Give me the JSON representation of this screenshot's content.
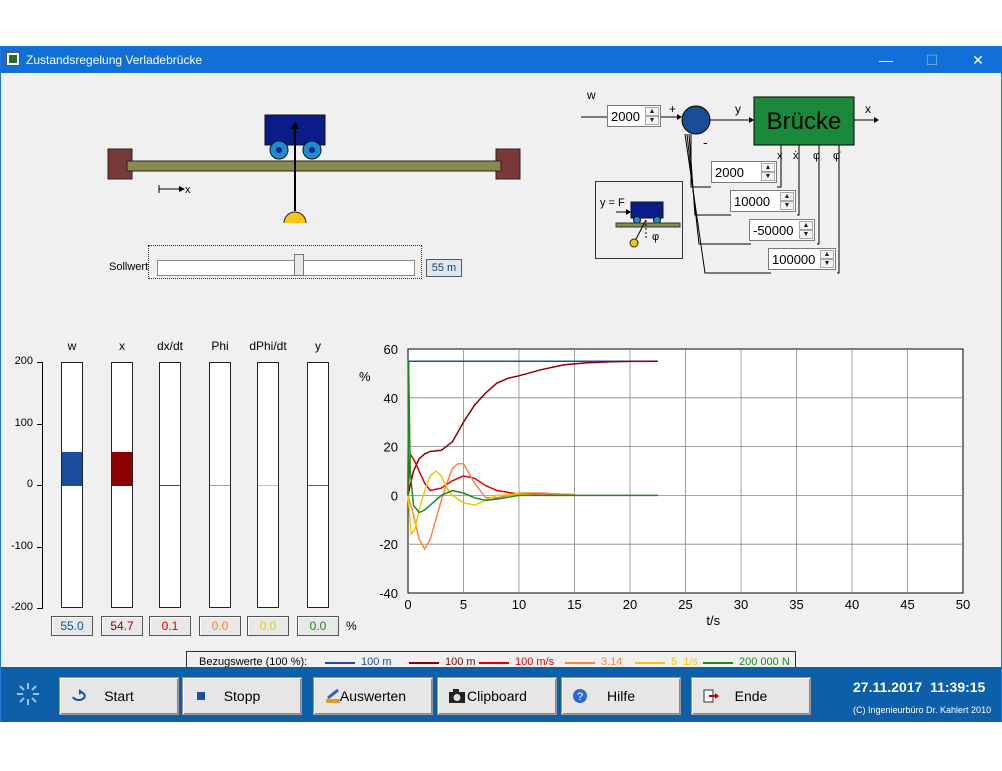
{
  "window": {
    "title": "Zustandsregelung Verladebrücke",
    "min": "—",
    "max": "☐",
    "close": "✕"
  },
  "crane": {
    "axis_label": "x",
    "slider_label": "Sollwert",
    "slider_value": "55 m",
    "slider_fraction": 0.55
  },
  "block": {
    "w_label": "w",
    "w_value": "2000",
    "plus": "+",
    "minus": "-",
    "y_label": "y",
    "plant": "Brücke",
    "out_label": "x",
    "state_labels": [
      "x",
      "ẋ",
      "φ",
      "φ̇"
    ],
    "gains": [
      "2000",
      "10000",
      "-50000",
      "100000"
    ],
    "inset_label": "y = F",
    "inset_phi": "φ"
  },
  "bars": {
    "labels": [
      "w",
      "x",
      "dx/dt",
      "Phi",
      "dPhi/dt",
      "y"
    ],
    "values": [
      "55.0",
      "54.7",
      "0.1",
      "0.0",
      "0.0",
      "0.0"
    ],
    "colors": [
      "#1a4fa0",
      "#8b0000",
      "#e00000",
      "#ff8040",
      "#f0c800",
      "#1a8a1a"
    ],
    "ticks": [
      "200",
      "100",
      "0",
      "-100",
      "-200"
    ],
    "percent": "%"
  },
  "chart_data": {
    "type": "line",
    "ylabel": "%",
    "xlabel": "t/s",
    "xlim": [
      0,
      50
    ],
    "ylim": [
      -40,
      60
    ],
    "xticks": [
      "0",
      "5",
      "10",
      "15",
      "20",
      "25",
      "30",
      "35",
      "40",
      "45",
      "50"
    ],
    "yticks": [
      "60",
      "40",
      "20",
      "0",
      "-20",
      "-40"
    ],
    "grid": true,
    "series": [
      {
        "name": "100 m",
        "color": "#1a4fa0",
        "x": [
          0,
          0.05,
          22.5
        ],
        "y": [
          0,
          55,
          55
        ]
      },
      {
        "name": "100 m",
        "color": "#8b0000",
        "x": [
          0,
          0.5,
          1,
          1.5,
          2,
          3,
          4,
          5,
          6,
          7,
          8,
          9,
          10,
          12,
          14,
          16,
          18,
          20,
          22.5
        ],
        "y": [
          0,
          10,
          15,
          17,
          18,
          18.5,
          22,
          30,
          37,
          42,
          46,
          48,
          49,
          51.5,
          53.5,
          54.3,
          54.7,
          54.9,
          55
        ]
      },
      {
        "name": "100 m/s",
        "color": "#e00000",
        "x": [
          0,
          0.2,
          0.6,
          1,
          1.5,
          2,
          3,
          4,
          5,
          6,
          7,
          8,
          10,
          12,
          15
        ],
        "y": [
          0,
          17,
          14,
          10,
          5,
          2,
          3,
          6,
          8,
          7,
          4,
          2,
          0.5,
          0.8,
          0.3
        ]
      },
      {
        "name": "3.14",
        "color": "#ff8040",
        "x": [
          0,
          0.5,
          1,
          1.5,
          2,
          2.5,
          3,
          3.5,
          4,
          4.5,
          5,
          5.5,
          6,
          7,
          8,
          9,
          10,
          12,
          15
        ],
        "y": [
          0,
          -8,
          -18,
          -22,
          -18,
          -10,
          -2,
          5,
          11,
          13,
          13,
          9,
          5,
          -1,
          -1,
          0,
          1,
          1,
          0.2
        ]
      },
      {
        "name": "5  1/s",
        "color": "#f0c800",
        "x": [
          0,
          0.3,
          0.6,
          1,
          1.5,
          2,
          2.5,
          3,
          3.5,
          4,
          5,
          6,
          7,
          8,
          10,
          12,
          15
        ],
        "y": [
          0,
          -16,
          -14,
          -6,
          2,
          8,
          10,
          8,
          3,
          0,
          -3,
          -4,
          -2,
          0,
          0.5,
          0,
          0
        ]
      },
      {
        "name": "200 000 N",
        "color": "#1a8a1a",
        "x": [
          0,
          0.05,
          0.2,
          0.5,
          1,
          1.5,
          2,
          3,
          4,
          5,
          6,
          7,
          8,
          10,
          12,
          15,
          20,
          22.5
        ],
        "y": [
          0,
          55,
          10,
          -4,
          -7,
          -6,
          -4,
          0,
          2,
          1,
          -1,
          -2,
          -1.5,
          0,
          0,
          0,
          0,
          0
        ]
      }
    ]
  },
  "legend": {
    "title": "Bezugswerte (100 %):",
    "items": [
      "100 m",
      "100 m",
      "100 m/s",
      "3.14",
      "5  1/s",
      "200 000 N"
    ]
  },
  "taskbar": {
    "buttons": [
      "Start",
      "Stopp",
      "Auswerten",
      "Clipboard",
      "Hilfe",
      "Ende"
    ],
    "datetime": "27.11.2017  11:39:15",
    "copyright": "(C) Ingenieurbüro Dr. Kahlert 2010"
  }
}
